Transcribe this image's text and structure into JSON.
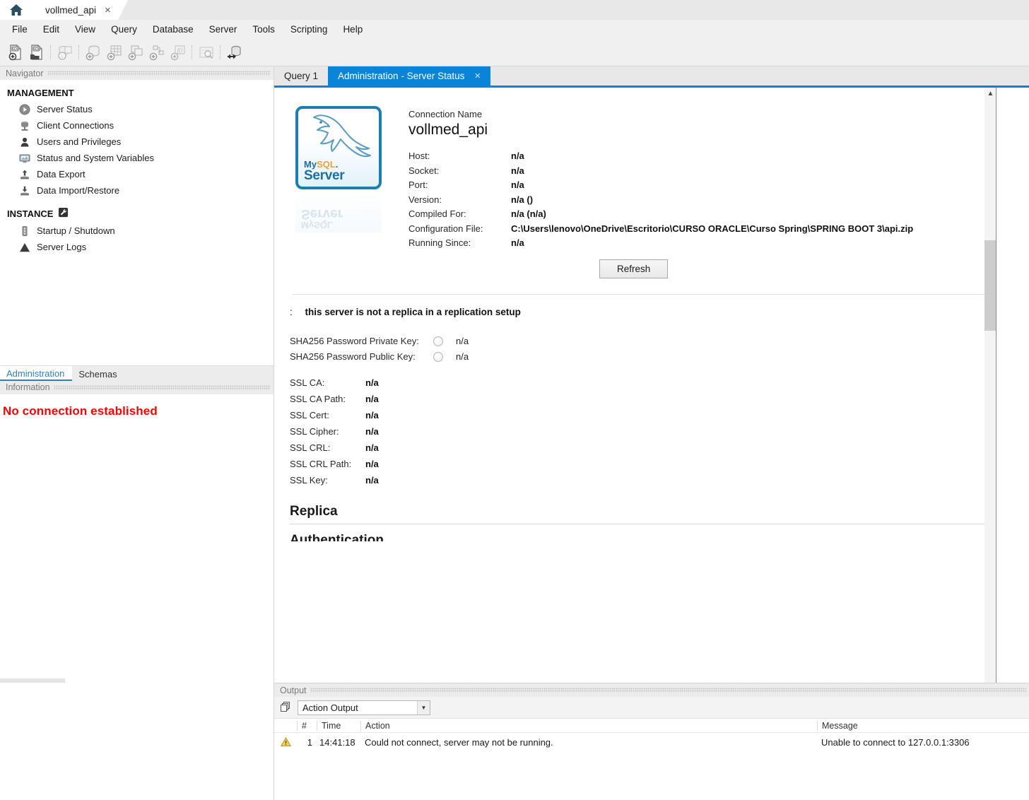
{
  "window": {
    "home_tab_icon": "home-icon",
    "connection_tab_label": "vollmed_api",
    "tab_close_glyph": "×"
  },
  "menubar": {
    "items": [
      {
        "label": "File"
      },
      {
        "label": "Edit"
      },
      {
        "label": "View"
      },
      {
        "label": "Query"
      },
      {
        "label": "Database"
      },
      {
        "label": "Server"
      },
      {
        "label": "Tools"
      },
      {
        "label": "Scripting"
      },
      {
        "label": "Help"
      }
    ]
  },
  "toolbar": {
    "buttons": [
      {
        "name": "new-sql-tab-icon"
      },
      {
        "name": "open-sql-script-icon"
      },
      {
        "name": "connection-info-icon"
      },
      {
        "name": "create-schema-icon"
      },
      {
        "name": "create-table-icon"
      },
      {
        "name": "create-view-icon"
      },
      {
        "name": "create-procedure-icon"
      },
      {
        "name": "create-function-icon"
      },
      {
        "name": "search-data-icon"
      },
      {
        "name": "reconnect-server-icon"
      }
    ]
  },
  "navigator": {
    "panel_title": "Navigator",
    "groups": [
      {
        "title": "MANAGEMENT",
        "items": [
          {
            "label": "Server Status",
            "icon": "play-circle-icon"
          },
          {
            "label": "Client Connections",
            "icon": "server-stack-icon"
          },
          {
            "label": "Users and Privileges",
            "icon": "user-icon"
          },
          {
            "label": "Status and System Variables",
            "icon": "monitor-chart-icon"
          },
          {
            "label": "Data Export",
            "icon": "upload-icon"
          },
          {
            "label": "Data Import/Restore",
            "icon": "download-icon"
          }
        ]
      },
      {
        "title": "INSTANCE",
        "badge_icon": "wrench-icon",
        "items": [
          {
            "label": "Startup / Shutdown",
            "icon": "power-strip-icon"
          },
          {
            "label": "Server Logs",
            "icon": "warning-triangle-icon"
          }
        ]
      }
    ],
    "tabs": [
      {
        "label": "Administration",
        "active": true
      },
      {
        "label": "Schemas",
        "active": false
      }
    ],
    "information_title": "Information",
    "information_message": "No connection established",
    "information_color": "#ff0000"
  },
  "editor_tabs": [
    {
      "label": "Query 1",
      "active": false
    },
    {
      "label": "Administration - Server Status",
      "active": true,
      "closable": true
    }
  ],
  "server_status": {
    "logo": {
      "brand_my": "My",
      "brand_sql": "SQL",
      "brand_dot": ".",
      "brand_server": "Server"
    },
    "connection_name_label": "Connection Name",
    "connection_name_value": "vollmed_api",
    "fields": [
      {
        "label": "Host:",
        "value": "n/a"
      },
      {
        "label": "Socket:",
        "value": "n/a"
      },
      {
        "label": "Port:",
        "value": "n/a"
      },
      {
        "label": "Version:",
        "value": "n/a ()"
      },
      {
        "label": "Compiled For:",
        "value": "n/a  (n/a)"
      },
      {
        "label": "Configuration File:",
        "value": "C:\\Users\\lenovo\\OneDrive\\Escritorio\\CURSO ORACLE\\Curso Spring\\SPRING BOOT 3\\api.zip"
      },
      {
        "label": "Running Since:",
        "value": "n/a"
      }
    ],
    "refresh_label": "Refresh",
    "replication_prefix": ":",
    "replication_note": "this server is not a replica in a replication setup",
    "key_rows": [
      {
        "label": "SHA256 Password Private Key:",
        "value": "n/a"
      },
      {
        "label": "SHA256 Password Public Key:",
        "value": "n/a"
      }
    ],
    "ssl_rows": [
      {
        "label": "SSL CA:",
        "value": "n/a"
      },
      {
        "label": "SSL CA Path:",
        "value": "n/a"
      },
      {
        "label": "SSL Cert:",
        "value": "n/a"
      },
      {
        "label": "SSL Cipher:",
        "value": "n/a"
      },
      {
        "label": "SSL CRL:",
        "value": "n/a"
      },
      {
        "label": "SSL CRL Path:",
        "value": "n/a"
      },
      {
        "label": "SSL Key:",
        "value": "n/a"
      }
    ],
    "section_replica": "Replica",
    "section_authentication": "Authentication"
  },
  "output": {
    "panel_title": "Output",
    "selected_view": "Action Output",
    "columns": {
      "num": "#",
      "time": "Time",
      "action": "Action",
      "message": "Message"
    },
    "rows": [
      {
        "status_icon": "warning-triangle-icon",
        "num": "1",
        "time": "14:41:18",
        "action": "Could not connect, server may not be running.",
        "message": "Unable to connect to 127.0.0.1:3306"
      }
    ]
  },
  "colors": {
    "accent_blue": "#0a84d8",
    "tab_link_blue": "#2f7fc4",
    "error_red": "#ff0000",
    "warning_yellow": "#f5c518"
  }
}
